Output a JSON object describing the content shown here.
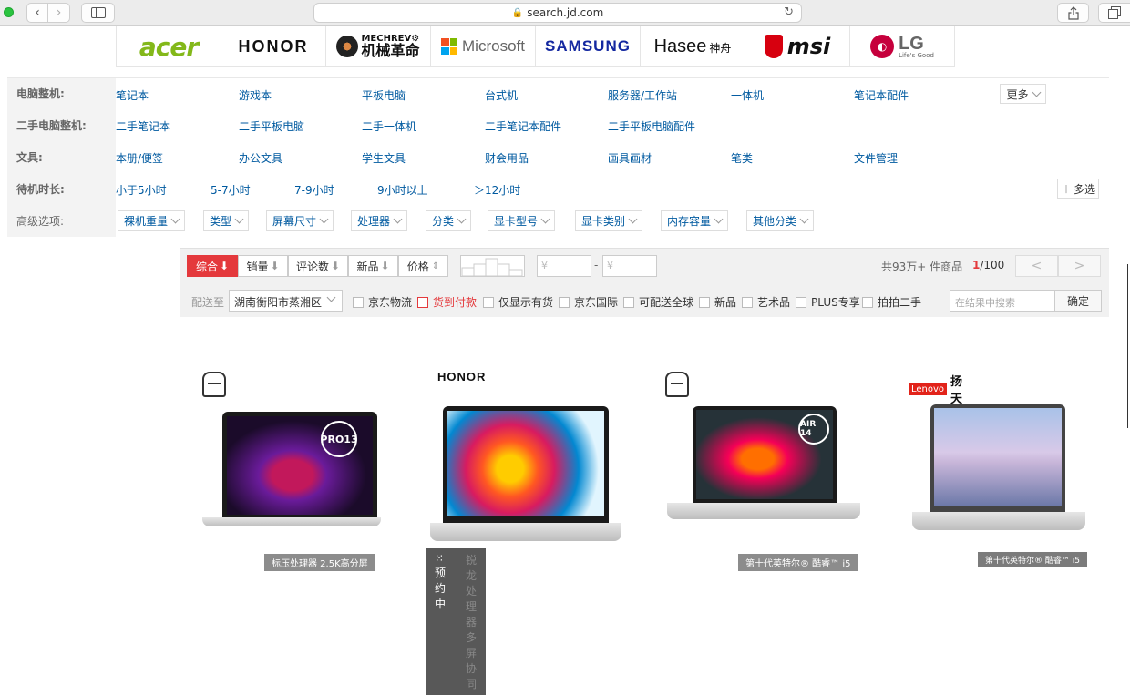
{
  "browser": {
    "url": "search.jd.com",
    "icons": [
      "back-icon",
      "forward-icon",
      "sidebar-icon",
      "lock-icon",
      "reload-icon",
      "share-icon",
      "tabs-icon"
    ]
  },
  "brands": {
    "acer": "acer",
    "honor": "HONOR",
    "mechrevo_en": "MECHREV⚙",
    "mechrevo_cn": "机械革命",
    "microsoft": "Microsoft",
    "samsung": "SAMSUNG",
    "hasee": "Hasee",
    "hasee_cn": "神舟",
    "msi": "msi",
    "lg": "LG",
    "lg_sub": "Life's Good"
  },
  "filters": {
    "rows": [
      {
        "key": "电脑整机:",
        "values": [
          "笔记本",
          "游戏本",
          "平板电脑",
          "台式机",
          "服务器/工作站",
          "一体机",
          "笔记本配件"
        ],
        "more": "更多"
      },
      {
        "key": "二手电脑整机:",
        "values": [
          "二手笔记本",
          "二手平板电脑",
          "二手一体机",
          "二手笔记本配件",
          "二手平板电脑配件"
        ]
      },
      {
        "key": "文具:",
        "values": [
          "本册/便签",
          "办公文具",
          "学生文具",
          "财会用品",
          "画具画材",
          "笔类",
          "文件管理"
        ]
      },
      {
        "key": "待机时长:",
        "values": [
          "小于5小时",
          "5-7小时",
          "7-9小时",
          "9小时以上",
          "＞12小时"
        ],
        "multi": "多选"
      },
      {
        "key": "高级选项:",
        "values": [
          "裸机重量",
          "类型",
          "屏幕尺寸",
          "处理器",
          "分类",
          "显卡型号",
          "显卡类别",
          "内存容量",
          "其他分类"
        ]
      }
    ]
  },
  "sort": {
    "items": [
      "综合",
      "销量",
      "评论数",
      "新品",
      "价格"
    ],
    "price_min_placeholder": "¥",
    "price_max_placeholder": "¥",
    "price_dash": "-",
    "total_prefix": "共",
    "total_count": "93万+",
    "total_suffix": " 件商品",
    "page_current": "1",
    "page_total": "/100",
    "prev": "<",
    "next": ">"
  },
  "shipping": {
    "label": "配送至",
    "location": "湖南衡阳市蒸湘区",
    "checkboxes": [
      "京东物流",
      "货到付款",
      "仅显示有货",
      "京东国际",
      "可配送全球",
      "新品",
      "艺术品",
      "PLUS专享",
      "拍拍二手"
    ],
    "search_placeholder": "在结果中搜索",
    "confirm": "确定"
  },
  "products": [
    {
      "brand": "XIAOXIN",
      "model_badge": "PRO13",
      "caption": "标压处理器 2.5K高分屏"
    },
    {
      "brand": "HONOR",
      "badge": "预约中",
      "caption": "锐龙处理器   多屏协同"
    },
    {
      "brand": "XIAOXIN",
      "model_badge": "AIR 14",
      "caption": "第十代英特尔® 酷睿™ i5"
    },
    {
      "brand_box": "Lenovo",
      "brand_cn": "扬天",
      "caption": "第十代英特尔® 酷睿™ i5"
    }
  ]
}
